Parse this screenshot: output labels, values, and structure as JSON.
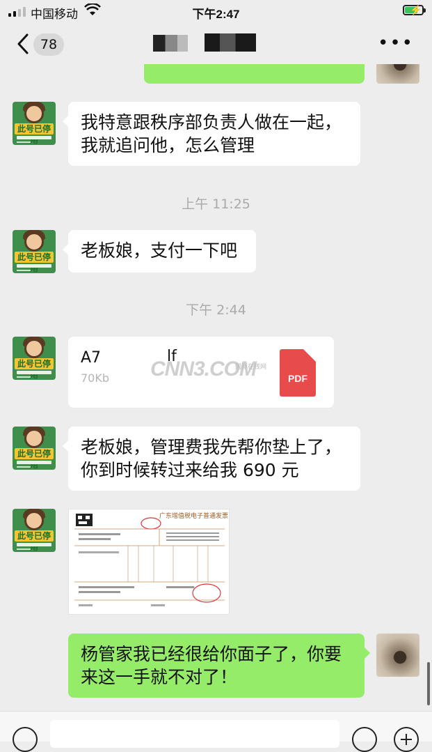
{
  "status_bar": {
    "carrier": "中国移动",
    "time": "下午2:47",
    "signal_icon": "signal-icon",
    "wifi_icon": "wifi-icon",
    "battery_icon": "battery-charging-icon"
  },
  "nav": {
    "back_icon": "chevron-left-icon",
    "unread_count": "78",
    "more_icon": "more-dots-icon"
  },
  "messages": [
    {
      "side": "left",
      "type": "text",
      "text": "我特意跟秩序部负责人做在一起，\n我就追问他，怎么管理"
    },
    {
      "type": "timestamp",
      "text": "上午 11:25"
    },
    {
      "side": "left",
      "type": "text",
      "text": "老板娘，支付一下吧"
    },
    {
      "type": "timestamp",
      "text": "下午 2:44"
    },
    {
      "side": "left",
      "type": "file",
      "name": "A7",
      "ext": "lf",
      "size": "70Kb",
      "icon_label": "PDF"
    },
    {
      "side": "left",
      "type": "text",
      "text": "老板娘，管理费我先帮你垫上了，\n你到时候转过来给我 690 元"
    },
    {
      "side": "left",
      "type": "image",
      "title": "广东增值税电子普通发票"
    },
    {
      "side": "right",
      "type": "text",
      "text": "杨管家我已经很给你面子了，你要\n来这一手就不对了！"
    }
  ],
  "avatar_left": {
    "label": "此号已停用"
  },
  "watermark": {
    "text": "CNN3.COM",
    "sub": "国际在线网"
  },
  "colors": {
    "background": "#ededed",
    "bubble_self": "#95ec69",
    "bubble_other": "#ffffff",
    "timestamp": "#aaaaaa",
    "pdf_icon": "#e74b4b"
  }
}
